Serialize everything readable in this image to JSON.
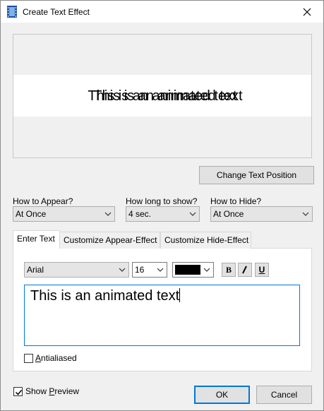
{
  "window": {
    "title": "Create Text Effect"
  },
  "preview": {
    "text_a": "This is an animated text",
    "text_b": "This is an animated text"
  },
  "buttons": {
    "change_position": "Change Text Position",
    "ok": "OK",
    "cancel": "Cancel"
  },
  "appear": {
    "label": "How to Appear?",
    "value": "At Once"
  },
  "duration": {
    "label": "How long to show?",
    "value": "4 sec."
  },
  "hide": {
    "label": "How to Hide?",
    "value": "At Once"
  },
  "tabs": [
    "Enter Text",
    "Customize Appear-Effect",
    "Customize Hide-Effect"
  ],
  "format": {
    "font": "Arial",
    "size": "16",
    "color": "#000000",
    "bold": "B",
    "italic": "I",
    "underline": "U"
  },
  "editor": {
    "text": "This is an animated text"
  },
  "antialiased": {
    "label": "Antialiased",
    "checked": false
  },
  "show_preview": {
    "label": "Show Preview",
    "checked": true
  }
}
